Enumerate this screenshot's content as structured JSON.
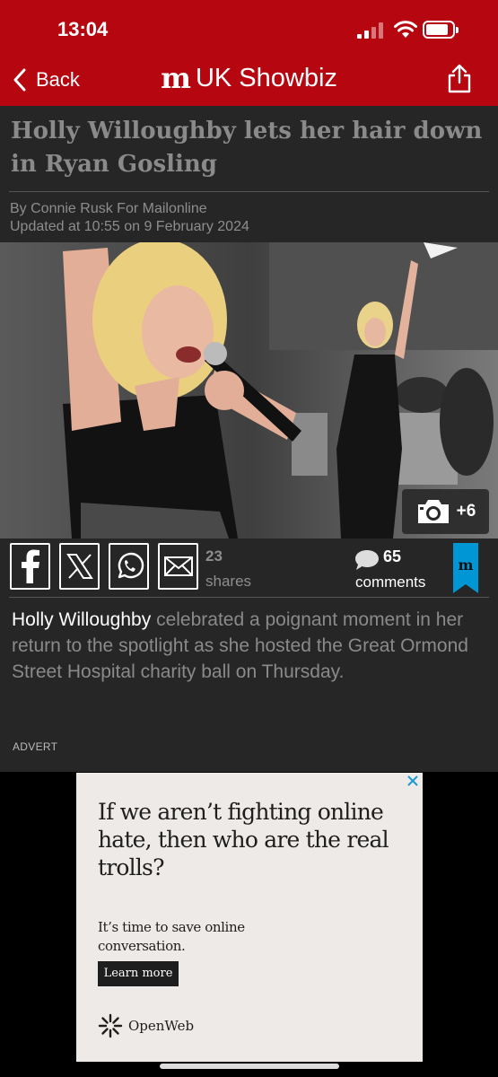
{
  "status_bar": {
    "time": "13:04"
  },
  "nav": {
    "back_label": "Back",
    "logo_mark": "m",
    "section_title": "UK Showbiz",
    "share_icon": "share-icon",
    "accent_color": "#b6060f"
  },
  "article": {
    "headline": "Holly Willoughby lets her hair down in Ryan Gosling",
    "byline": "By Connie Rusk For Mailonline",
    "updated": "Updated at 10:55 on 9 February 2024",
    "gallery_count": "+6",
    "share": {
      "count": "23",
      "label": "shares",
      "buttons": [
        "facebook-icon",
        "x-icon",
        "whatsapp-icon",
        "email-icon"
      ]
    },
    "comments": {
      "count": "65",
      "label": "comments"
    },
    "intro_link": "Holly Willoughby",
    "intro_text": " celebrated a poignant moment in her return to the spotlight as she hosted the Great Ormond Street Hospital charity ball on Thursday.",
    "advert_label": "ADVERT"
  },
  "ad": {
    "headline": "If we aren’t fighting online hate, then who are the real trolls?",
    "subtext": "It’s time to save online conversation.",
    "cta": "Learn more",
    "brand": "OpenWeb"
  }
}
